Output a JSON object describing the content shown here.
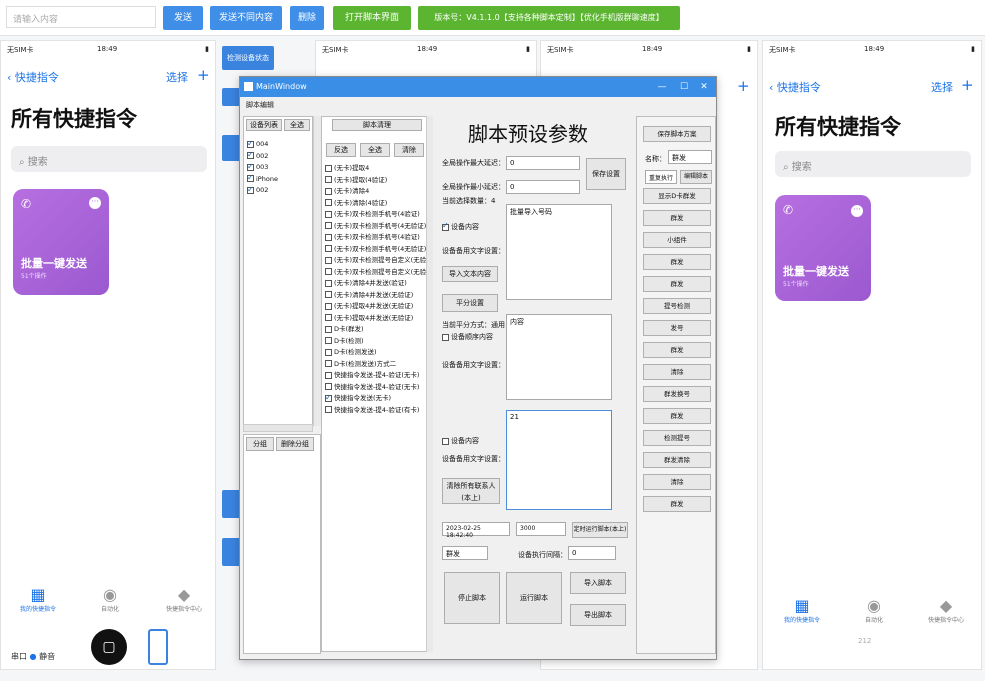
{
  "toolbar": {
    "input_placeholder": "请输入内容",
    "btn_all": "发送",
    "btn_send_diff": "发送不同内容",
    "btn_delete": "删除",
    "btn_open_script": "打开脚本界面",
    "version": "版本号：V4.1.1.0【支持各种脚本定制】【优化手机版群聊速度】"
  },
  "phone_left": {
    "carrier": "无SIM卡",
    "time": "18:49",
    "back": "快捷指令",
    "select": "选择",
    "plus": "+",
    "title": "所有快捷指令",
    "search": "搜索",
    "card_label": "批量一键发送",
    "card_sub": "51个操作",
    "tab_1": "我的快捷指令",
    "tab_2": "自动化",
    "tab_3": "快捷指令中心",
    "bottom_text": "串口",
    "bottom_text2": "静音"
  },
  "phone_right": {
    "carrier": "无SIM卡",
    "time": "18:49",
    "back": "快捷指令",
    "select": "选择",
    "plus": "+",
    "title": "所有快捷指令",
    "search": "搜索",
    "card_label": "批量一键发送",
    "card_sub": "51个操作",
    "tab_1": "我的快捷指令",
    "tab_2": "自动化",
    "tab_3": "快捷指令中心",
    "page": "212"
  },
  "phone_mid1": {
    "carrier": "无SIM卡",
    "time": "18:49"
  },
  "phone_mid2": {
    "carrier": "无SIM卡",
    "time": "18:49"
  },
  "left_buttons": [
    "检测设备状态"
  ],
  "window": {
    "title": "MainWindow",
    "menu": "脚本编辑",
    "dev_header_a": "设备列表",
    "dev_header_b": "全选",
    "devices": [
      "004",
      "002",
      "003",
      "iPhone",
      "002"
    ],
    "btn_group": "分组",
    "btn_del_group": "删除分组",
    "script_list_header": "脚本清理",
    "btn_invert": "反选",
    "btn_all": "全选",
    "btn_clear": "清除",
    "script_items": [
      "(无卡)提取4",
      "(无卡)提取(4验证)",
      "(无卡)清除4",
      "(无卡)清除(4验证)",
      "(无卡)双卡检测手机号(4验证)",
      "(无卡)双卡检测手机号(4无验证)",
      "(无卡)双卡检测手机号(4验证)",
      "(无卡)双卡检测手机号(4无验证)",
      "(无卡)双卡检测提号自定义(无验证)",
      "(无卡)双卡检测提号自定义(无验证)",
      "(无卡)清除4并发送(验证)",
      "(无卡)清除4并发送(无验证)",
      "(无卡)提取4并发送(无验证)",
      "(无卡)提取4并发送(无验证)",
      "D卡(群发)",
      "D卡(检测)",
      "D卡(检测发送)",
      "D卡(检测发送)方式二",
      "快捷指令发送-提4-验证(无卡)",
      "快捷指令发送-提4-验证(无卡)",
      "快捷指令发送(无卡)",
      "快捷指令发送-提4-验证(有卡)"
    ],
    "script_checked_index": 20,
    "params_title": "脚本预设参数",
    "lbl_max_interval": "全局操作最大延迟：",
    "val_max_interval": "0",
    "lbl_min_interval": "全局操作最小延迟：",
    "val_min_interval": "0",
    "lbl_selected_count": "当前选择数量：4",
    "btn_save_settings": "保存设置",
    "chk_device_content": "设备内容",
    "lbl_device_text": "设备备用文字设置：",
    "btn_import_text": "导入文本内容",
    "ta1_value": "批量导入号码",
    "btn_avg_set": "平分设置",
    "lbl_avg_hint": "当前平分方式：通用",
    "chk_device_sequence": "设备顺序内容",
    "lbl_device_text2": "设备备用文字设置：",
    "ta2_value": "内容",
    "chk_device_content2": "设备内容",
    "lbl_device_text3": "设备备用文字设置：",
    "ta3_value": "21",
    "btn_clear_phones": "清除所有联系人(本上)",
    "datetime": "2023-02-25 18:42:40",
    "interval_val": "3000",
    "btn_timed_run": "定时运行脚本(本上)",
    "sel_group": "群发",
    "lbl_exec_interval": "设备执行间隔：",
    "val_exec_interval": "0",
    "btn_stop": "停止脚本",
    "btn_run": "运行脚本",
    "btn_import_script": "导入脚本",
    "btn_export_script": "导出脚本",
    "rp_save_plan": "保存脚本方案",
    "rp_name_label": "名称：",
    "rp_name_value": "群发",
    "rp_select": "重复执行",
    "rp_edit": "编辑脚本",
    "rp_items": [
      "显示D卡群发",
      "群发",
      "小组件",
      "群发",
      "群发",
      "提号检测",
      "发号",
      "群发",
      "清除",
      "群发换号",
      "群发",
      "检测提号",
      "群发清除",
      "清除",
      "群发"
    ]
  }
}
